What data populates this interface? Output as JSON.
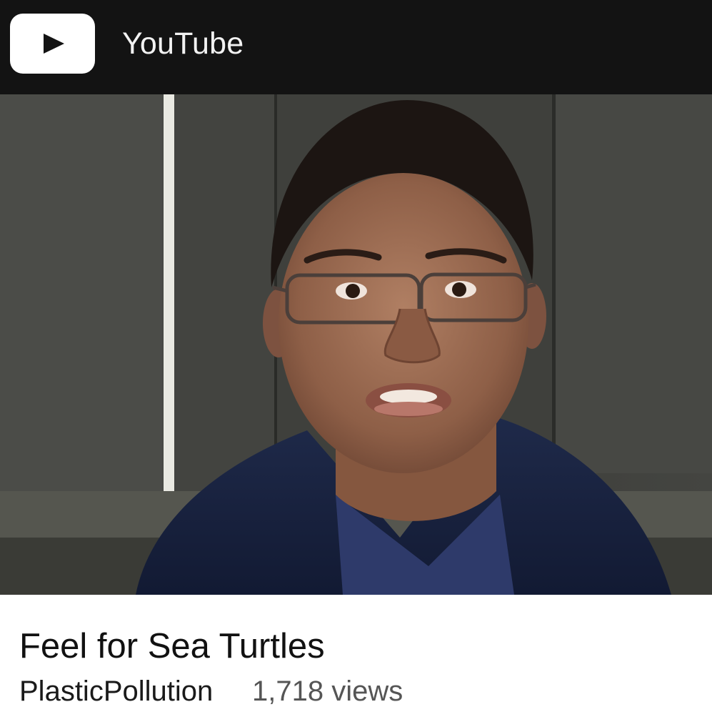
{
  "header": {
    "app_name": "YouTube",
    "logo_icon": "youtube-play-logo-icon"
  },
  "video": {
    "thumbnail_icon": "video-thumbnail-image",
    "title": "Feel for Sea Turtles",
    "channel": "PlasticPollution",
    "views": "1,718 views"
  },
  "colors": {
    "header_bg": "#131313",
    "logo_bg": "#ffffff",
    "title_text": "#111111",
    "meta_text": "#555555"
  }
}
